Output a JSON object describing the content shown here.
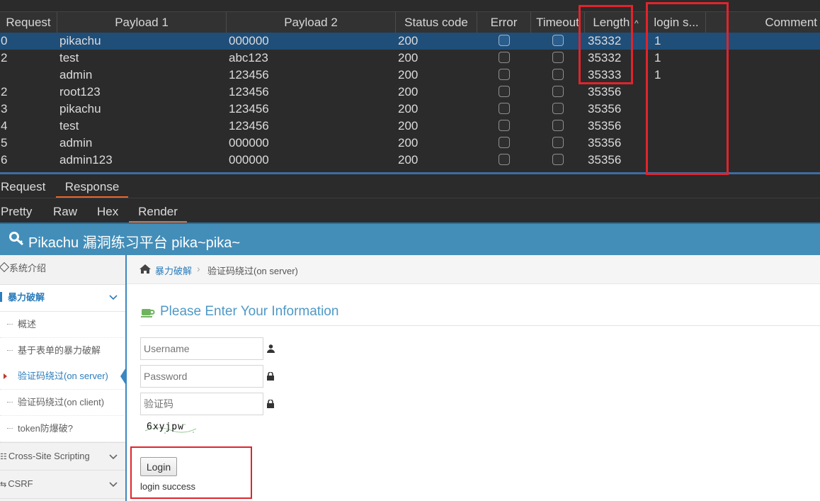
{
  "results_table": {
    "columns": [
      "Request",
      "Payload 1",
      "Payload 2",
      "Status code",
      "Error",
      "Timeout",
      "Length",
      "login s...",
      "Comment"
    ],
    "sort_indicator": "^",
    "rows": [
      {
        "request": "0",
        "payload1": "pikachu",
        "payload2": "000000",
        "status": "200",
        "length": "35332",
        "login": "1",
        "selected": true
      },
      {
        "request": "2",
        "payload1": "test",
        "payload2": "abc123",
        "status": "200",
        "length": "35332",
        "login": "1"
      },
      {
        "request": "",
        "payload1": "admin",
        "payload2": "123456",
        "status": "200",
        "length": "35333",
        "login": "1"
      },
      {
        "request": "2",
        "payload1": "root123",
        "payload2": "123456",
        "status": "200",
        "length": "35356",
        "login": ""
      },
      {
        "request": "3",
        "payload1": "pikachu",
        "payload2": "123456",
        "status": "200",
        "length": "35356",
        "login": ""
      },
      {
        "request": "4",
        "payload1": "test",
        "payload2": "123456",
        "status": "200",
        "length": "35356",
        "login": ""
      },
      {
        "request": "5",
        "payload1": "admin",
        "payload2": "000000",
        "status": "200",
        "length": "35356",
        "login": ""
      },
      {
        "request": "6",
        "payload1": "admin123",
        "payload2": "000000",
        "status": "200",
        "length": "35356",
        "login": ""
      }
    ]
  },
  "message_tabs": {
    "request": "Request",
    "response": "Response"
  },
  "view_tabs": {
    "pretty": "Pretty",
    "raw": "Raw",
    "hex": "Hex",
    "render": "Render"
  },
  "site": {
    "title": "Pikachu 漏洞练习平台 pika~pika~",
    "sidebar": {
      "intro": "系统介绍",
      "bruteforce": "暴力破解",
      "sub": [
        "概述",
        "基于表单的暴力破解",
        "验证码绕过(on server)",
        "验证码绕过(on client)",
        "token防爆破?"
      ],
      "xss": "Cross-Site Scripting",
      "csrf": "CSRF"
    },
    "breadcrumb": {
      "parent": "暴力破解",
      "current": "验证码绕过(on server)"
    },
    "form": {
      "heading": "Please Enter Your Information",
      "username_placeholder": "Username",
      "password_placeholder": "Password",
      "captcha_placeholder": "验证码",
      "captcha_text": "6xyjpw",
      "login_button": "Login",
      "result": "login success"
    }
  },
  "colors": {
    "highlight_box": "#e0242c",
    "selected_row": "#1f4e79",
    "nav_blue": "#438eb9",
    "accent_tab": "#e8692c"
  }
}
